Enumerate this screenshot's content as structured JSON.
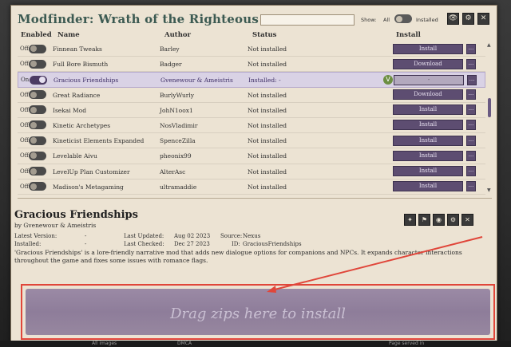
{
  "window": {
    "title": "Modfinder: Wrath of the Righteous",
    "show_label": "Show:",
    "show_all": "All",
    "show_installed": "Installed"
  },
  "columns": {
    "enabled": "Enabled",
    "name": "Name",
    "author": "Author",
    "status": "Status",
    "install": "Install"
  },
  "mods": [
    {
      "enabled": "Off",
      "name": "Finnean Tweaks",
      "author": "Barley",
      "status": "Not installed",
      "action": "Install",
      "more": "..."
    },
    {
      "enabled": "Off",
      "name": "Full Bore Bismuth",
      "author": "Badger",
      "status": "Not installed",
      "action": "Download",
      "more": "..."
    },
    {
      "enabled": "On",
      "name": "Gracious Friendships",
      "author": "Gvenewour & Ameistris",
      "status": "Installed: -",
      "action": "-",
      "more": "..."
    },
    {
      "enabled": "Off",
      "name": "Great Radiance",
      "author": "BurlyWurly",
      "status": "Not installed",
      "action": "Download",
      "more": "..."
    },
    {
      "enabled": "Off",
      "name": "Isekai Mod",
      "author": "JohN1oox1",
      "status": "Not installed",
      "action": "Install",
      "more": "..."
    },
    {
      "enabled": "Off",
      "name": "Kinetic Archetypes",
      "author": "NosVladimir",
      "status": "Not installed",
      "action": "Install",
      "more": "..."
    },
    {
      "enabled": "Off",
      "name": "Kineticist Elements Expanded",
      "author": "SpenceZilla",
      "status": "Not installed",
      "action": "Install",
      "more": "..."
    },
    {
      "enabled": "Off",
      "name": "Levelable Aivu",
      "author": "pheonix99",
      "status": "Not installed",
      "action": "Install",
      "more": "..."
    },
    {
      "enabled": "Off",
      "name": "LevelUp Plan Customizer",
      "author": "AlterAsc",
      "status": "Not installed",
      "action": "Install",
      "more": "..."
    },
    {
      "enabled": "Off",
      "name": "Madison's Metagaming",
      "author": "ultramaddie",
      "status": "Not installed",
      "action": "Install",
      "more": "..."
    }
  ],
  "detail": {
    "title": "Gracious Friendships",
    "author": "by Gvenewour & Ameistris",
    "latest_version_label": "Latest Version:",
    "latest_version": "-",
    "installed_label": "Installed:",
    "installed": "-",
    "last_updated_label": "Last Updated:",
    "last_updated": "Aug 02 2023",
    "last_checked_label": "Last Checked:",
    "last_checked": "Dec 27 2023",
    "source_label": "Source:",
    "source": "Nexus",
    "id_label": "ID:",
    "id": "GraciousFriendships",
    "description": "'Gracious Friendships' is a lore-friendly narrative mod that adds new dialogue options for companions and NPCs. It expands character interactions throughout the game and fixes some issues with romance flags."
  },
  "dropzone": {
    "text": "Drag zips here to install"
  },
  "footer": {
    "all_images": "All images",
    "dmca": "DMCA",
    "page_served": "Page served in"
  },
  "colors": {
    "title": "#3c5a52",
    "accent_purple": "#5d4d71",
    "annotation_red": "#e0463a"
  }
}
